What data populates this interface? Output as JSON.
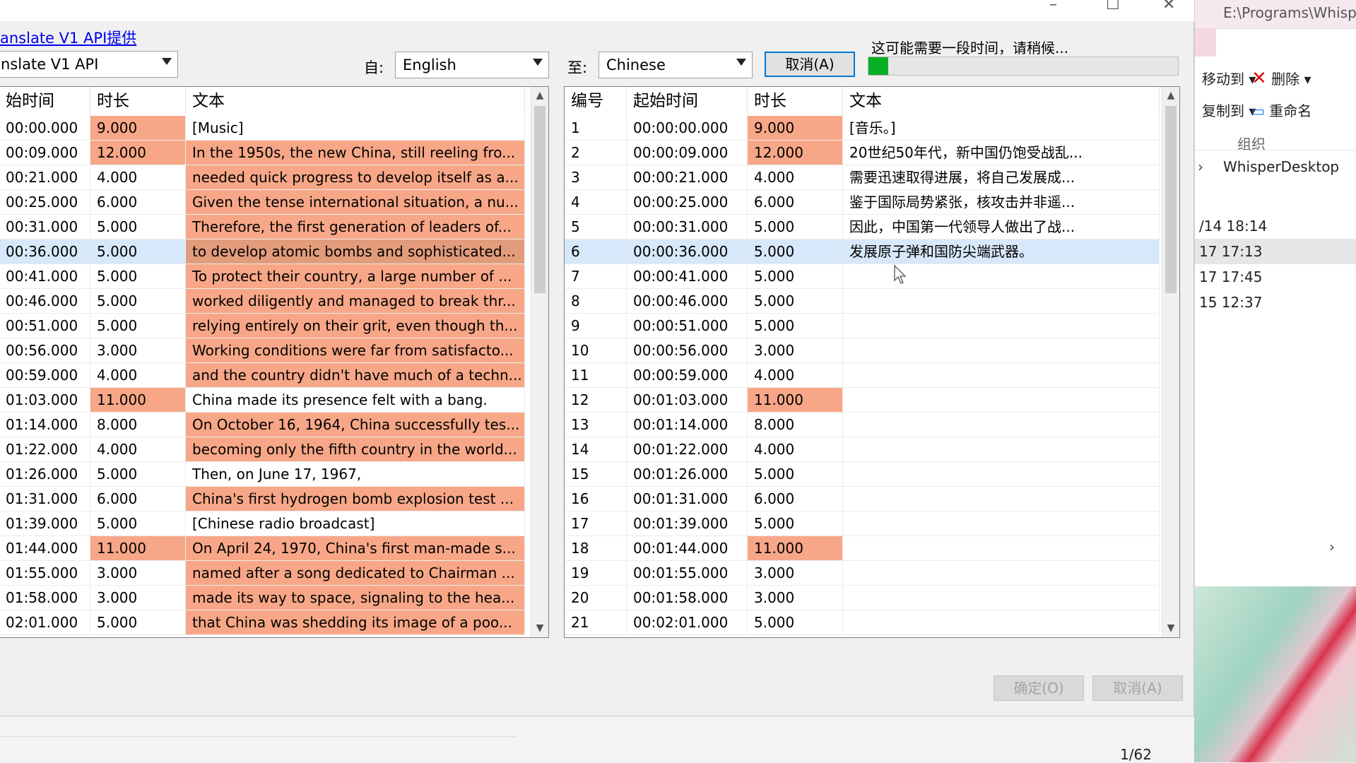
{
  "dialog": {
    "api_link": "anslate V1 API提供",
    "provider_value": "nslate V1 API",
    "from_label": "自:",
    "from_value": "English",
    "to_label": "至:",
    "to_value": "Chinese",
    "cancel_top": "取消(A)",
    "progress_text": "这可能需要一段时间，请稍候...",
    "progress_fraction": 0.065,
    "ok_button": "确定(O)",
    "cancel_button": "取消(A)"
  },
  "left_grid": {
    "headers": [
      "始时间",
      "时长",
      "文本"
    ],
    "rows": [
      {
        "start": "00:00.000",
        "duration": "9.000",
        "text": "[Music]",
        "hl_d": true,
        "hl_t": false
      },
      {
        "start": "00:09.000",
        "duration": "12.000",
        "text": "In the 1950s, the new China, still reeling fro...",
        "hl_d": true,
        "hl_t": true
      },
      {
        "start": "00:21.000",
        "duration": "4.000",
        "text": "needed quick progress to develop itself as a...",
        "hl_d": false,
        "hl_t": true
      },
      {
        "start": "00:25.000",
        "duration": "6.000",
        "text": "Given the tense international situation, a nu...",
        "hl_d": false,
        "hl_t": true
      },
      {
        "start": "00:31.000",
        "duration": "5.000",
        "text": "Therefore, the first generation of leaders of...",
        "hl_d": false,
        "hl_t": true
      },
      {
        "start": "00:36.000",
        "duration": "5.000",
        "text": "to develop atomic bombs and sophisticated...",
        "hl_d": false,
        "hl_t": true,
        "sel": true
      },
      {
        "start": "00:41.000",
        "duration": "5.000",
        "text": "To protect their country, a large number of ...",
        "hl_d": false,
        "hl_t": true
      },
      {
        "start": "00:46.000",
        "duration": "5.000",
        "text": "worked diligently and managed to break thr...",
        "hl_d": false,
        "hl_t": true
      },
      {
        "start": "00:51.000",
        "duration": "5.000",
        "text": "relying entirely on their grit, even though th...",
        "hl_d": false,
        "hl_t": true
      },
      {
        "start": "00:56.000",
        "duration": "3.000",
        "text": "Working conditions were far from satisfacto...",
        "hl_d": false,
        "hl_t": true
      },
      {
        "start": "00:59.000",
        "duration": "4.000",
        "text": "and the country didn't have much of a techn...",
        "hl_d": false,
        "hl_t": true
      },
      {
        "start": "01:03.000",
        "duration": "11.000",
        "text": "China made its presence felt with a bang.",
        "hl_d": true,
        "hl_t": false
      },
      {
        "start": "01:14.000",
        "duration": "8.000",
        "text": "On October 16, 1964, China successfully tes...",
        "hl_d": false,
        "hl_t": true
      },
      {
        "start": "01:22.000",
        "duration": "4.000",
        "text": "becoming only the fifth country in the world...",
        "hl_d": false,
        "hl_t": true
      },
      {
        "start": "01:26.000",
        "duration": "5.000",
        "text": "Then, on June 17, 1967,",
        "hl_d": false,
        "hl_t": false
      },
      {
        "start": "01:31.000",
        "duration": "6.000",
        "text": "China's first hydrogen bomb explosion test ...",
        "hl_d": false,
        "hl_t": true
      },
      {
        "start": "01:39.000",
        "duration": "5.000",
        "text": "[Chinese radio broadcast]",
        "hl_d": false,
        "hl_t": false
      },
      {
        "start": "01:44.000",
        "duration": "11.000",
        "text": "On April 24, 1970, China's first man-made s...",
        "hl_d": true,
        "hl_t": true
      },
      {
        "start": "01:55.000",
        "duration": "3.000",
        "text": "named after a song dedicated to Chairman ...",
        "hl_d": false,
        "hl_t": true
      },
      {
        "start": "01:58.000",
        "duration": "3.000",
        "text": "made its way to space, signaling to the hea...",
        "hl_d": false,
        "hl_t": true
      },
      {
        "start": "02:01.000",
        "duration": "5.000",
        "text": "that China was shedding its image of a poo...",
        "hl_d": false,
        "hl_t": true
      }
    ]
  },
  "right_grid": {
    "headers": [
      "编号",
      "起始时间",
      "时长",
      "文本"
    ],
    "rows": [
      {
        "num": "1",
        "start": "00:00:00.000",
        "duration": "9.000",
        "text": "[音乐。]",
        "hl_d": true,
        "hl_t": true
      },
      {
        "num": "2",
        "start": "00:00:09.000",
        "duration": "12.000",
        "text": "20世纪50年代，新中国仍饱受战乱...",
        "hl_d": true,
        "hl_t": true
      },
      {
        "num": "3",
        "start": "00:00:21.000",
        "duration": "4.000",
        "text": "需要迅速取得进展，将自己发展成...",
        "hl_d": false,
        "hl_t": true
      },
      {
        "num": "4",
        "start": "00:00:25.000",
        "duration": "6.000",
        "text": "鉴于国际局势紧张，核攻击并非遥...",
        "hl_d": false,
        "hl_t": true
      },
      {
        "num": "5",
        "start": "00:00:31.000",
        "duration": "5.000",
        "text": "因此，中国第一代领导人做出了战...",
        "hl_d": false,
        "hl_t": true
      },
      {
        "num": "6",
        "start": "00:00:36.000",
        "duration": "5.000",
        "text": "发展原子弹和国防尖端武器。",
        "hl_d": false,
        "hl_t": false,
        "sel": true
      },
      {
        "num": "7",
        "start": "00:00:41.000",
        "duration": "5.000",
        "text": "",
        "hl_d": false,
        "hl_t": false
      },
      {
        "num": "8",
        "start": "00:00:46.000",
        "duration": "5.000",
        "text": "",
        "hl_d": false,
        "hl_t": false
      },
      {
        "num": "9",
        "start": "00:00:51.000",
        "duration": "5.000",
        "text": "",
        "hl_d": false,
        "hl_t": false
      },
      {
        "num": "10",
        "start": "00:00:56.000",
        "duration": "3.000",
        "text": "",
        "hl_d": false,
        "hl_t": false
      },
      {
        "num": "11",
        "start": "00:00:59.000",
        "duration": "4.000",
        "text": "",
        "hl_d": false,
        "hl_t": false
      },
      {
        "num": "12",
        "start": "00:01:03.000",
        "duration": "11.000",
        "text": "",
        "hl_d": true,
        "hl_t": false
      },
      {
        "num": "13",
        "start": "00:01:14.000",
        "duration": "8.000",
        "text": "",
        "hl_d": false,
        "hl_t": false
      },
      {
        "num": "14",
        "start": "00:01:22.000",
        "duration": "4.000",
        "text": "",
        "hl_d": false,
        "hl_t": false
      },
      {
        "num": "15",
        "start": "00:01:26.000",
        "duration": "5.000",
        "text": "",
        "hl_d": false,
        "hl_t": false
      },
      {
        "num": "16",
        "start": "00:01:31.000",
        "duration": "6.000",
        "text": "",
        "hl_d": false,
        "hl_t": false
      },
      {
        "num": "17",
        "start": "00:01:39.000",
        "duration": "5.000",
        "text": "",
        "hl_d": false,
        "hl_t": false
      },
      {
        "num": "18",
        "start": "00:01:44.000",
        "duration": "11.000",
        "text": "",
        "hl_d": true,
        "hl_t": false
      },
      {
        "num": "19",
        "start": "00:01:55.000",
        "duration": "3.000",
        "text": "",
        "hl_d": false,
        "hl_t": false
      },
      {
        "num": "20",
        "start": "00:01:58.000",
        "duration": "3.000",
        "text": "",
        "hl_d": false,
        "hl_t": false
      },
      {
        "num": "21",
        "start": "00:02:01.000",
        "duration": "5.000",
        "text": "",
        "hl_d": false,
        "hl_t": false
      }
    ]
  },
  "explorer": {
    "path": "E:\\Programs\\Whisp",
    "move_to": "移动到",
    "delete": "删除",
    "copy_to": "复制到",
    "rename": "重命名",
    "organize": "组织",
    "breadcrumb": "WhisperDesktop",
    "dates": [
      "/14 18:14",
      "17 17:13",
      "17 17:45",
      "15 12:37"
    ]
  },
  "status": {
    "pager": "1/62"
  },
  "colors": {
    "highlight": "#f7a787",
    "selection": "#d7e8fa",
    "progress": "#06b025",
    "link": "#0000ee"
  }
}
